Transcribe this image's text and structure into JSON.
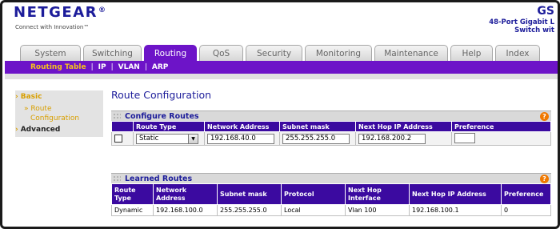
{
  "header": {
    "logo": "NETGEAR",
    "logo_mark": "®",
    "tagline": "Connect with Innovation™",
    "product_title": "GS",
    "product_sub_1": "48-Port Gigabit L",
    "product_sub_2": "Switch wit"
  },
  "tabs": [
    {
      "label": "System"
    },
    {
      "label": "Switching"
    },
    {
      "label": "Routing"
    },
    {
      "label": "QoS"
    },
    {
      "label": "Security"
    },
    {
      "label": "Monitoring"
    },
    {
      "label": "Maintenance"
    },
    {
      "label": "Help"
    },
    {
      "label": "Index"
    }
  ],
  "subnav": {
    "items": [
      "Routing Table",
      "IP",
      "VLAN",
      "ARP"
    ],
    "separator": "|"
  },
  "leftnav": {
    "basic": "Basic",
    "route_line1": "» Route",
    "route_line2": "Configuration",
    "advanced": "Advanced",
    "chevron": "›"
  },
  "page_title": "Route Configuration",
  "configure_routes": {
    "title": "Configure Routes",
    "help": "?",
    "columns": [
      "",
      "Route Type",
      "Network Address",
      "Subnet mask",
      "Next Hop IP Address",
      "Preference"
    ],
    "row": {
      "route_type": "Static",
      "network_address": "192.168.40.0",
      "subnet_mask": "255.255.255.0",
      "next_hop_ip": "192.168.200.2",
      "preference": ""
    }
  },
  "learned_routes": {
    "title": "Learned Routes",
    "help": "?",
    "columns": [
      "Route Type",
      "Network Address",
      "Subnet mask",
      "Protocol",
      "Next Hop Interface",
      "Next Hop IP Address",
      "Preference"
    ],
    "rows": [
      [
        "Dynamic",
        "192.168.100.0",
        "255.255.255.0",
        "Local",
        "Vlan 100",
        "192.168.100.1",
        "0"
      ]
    ]
  },
  "colors": {
    "brand": "#1c1c9a",
    "accent": "#6d14c8",
    "table_header": "#3b0aa0",
    "highlight": "#f6c21c"
  }
}
